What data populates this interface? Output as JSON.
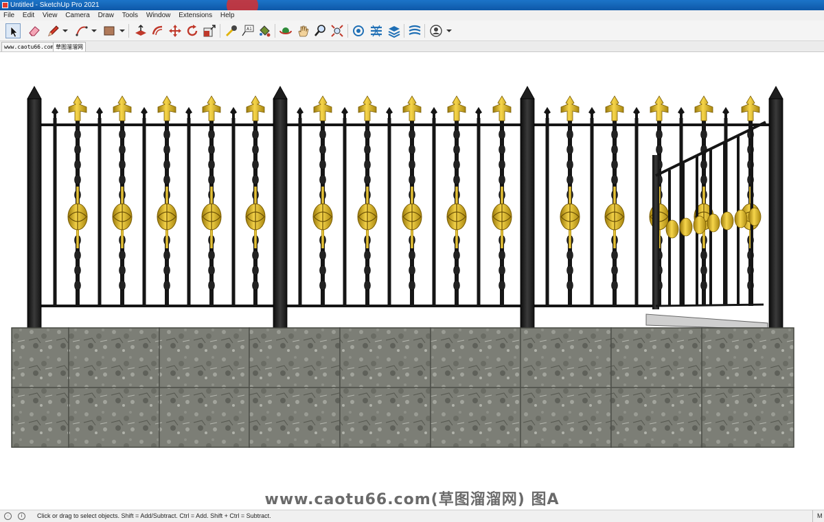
{
  "window": {
    "title": "Untitled - SketchUp Pro 2021"
  },
  "menu": [
    "File",
    "Edit",
    "View",
    "Camera",
    "Draw",
    "Tools",
    "Window",
    "Extensions",
    "Help"
  ],
  "toolbar": {
    "tools": [
      {
        "name": "select-tool",
        "icon": "arrow-cursor-icon"
      },
      {
        "name": "eraser-tool",
        "icon": "eraser-icon"
      },
      {
        "name": "line-tool",
        "icon": "pencil-icon"
      },
      {
        "name": "arc-tool",
        "icon": "arc-icon"
      },
      {
        "name": "shape-tool",
        "icon": "rectangle-icon"
      },
      {
        "name": "push-pull-tool",
        "icon": "push-pull-icon"
      },
      {
        "name": "offset-tool",
        "icon": "offset-icon"
      },
      {
        "name": "move-tool",
        "icon": "move-icon"
      },
      {
        "name": "rotate-tool",
        "icon": "rotate-icon"
      },
      {
        "name": "scale-tool",
        "icon": "scale-icon"
      },
      {
        "name": "tape-measure-tool",
        "icon": "tape-measure-icon"
      },
      {
        "name": "text-tool",
        "icon": "text-icon"
      },
      {
        "name": "paint-bucket-tool",
        "icon": "paint-bucket-icon"
      },
      {
        "name": "orbit-tool",
        "icon": "orbit-icon"
      },
      {
        "name": "pan-tool",
        "icon": "hand-icon"
      },
      {
        "name": "zoom-tool",
        "icon": "zoom-icon"
      },
      {
        "name": "zoom-extents-tool",
        "icon": "zoom-extents-icon"
      },
      {
        "name": "3d-warehouse-tool",
        "icon": "warehouse-icon"
      },
      {
        "name": "extension-warehouse-tool",
        "icon": "extension-icon"
      },
      {
        "name": "layout-tool",
        "icon": "layers-icon"
      },
      {
        "name": "extension-manager-tool",
        "icon": "extension-manager-icon"
      },
      {
        "name": "account-menu",
        "icon": "user-icon"
      }
    ]
  },
  "tabs": [
    "www.caotu66.com",
    "草图溜溜网"
  ],
  "watermark": "www.caotu66.com(草图溜溜网) 图A",
  "status": {
    "message": "Click or drag to select objects. Shift = Add/Subtract. Ctrl = Add. Shift + Ctrl = Subtract.",
    "measurements_label": "M"
  },
  "colors": {
    "iron": "#1a1a1a",
    "gold": "#e2b617",
    "stone": "#7c7e76",
    "titlebar": "#1565c0"
  }
}
